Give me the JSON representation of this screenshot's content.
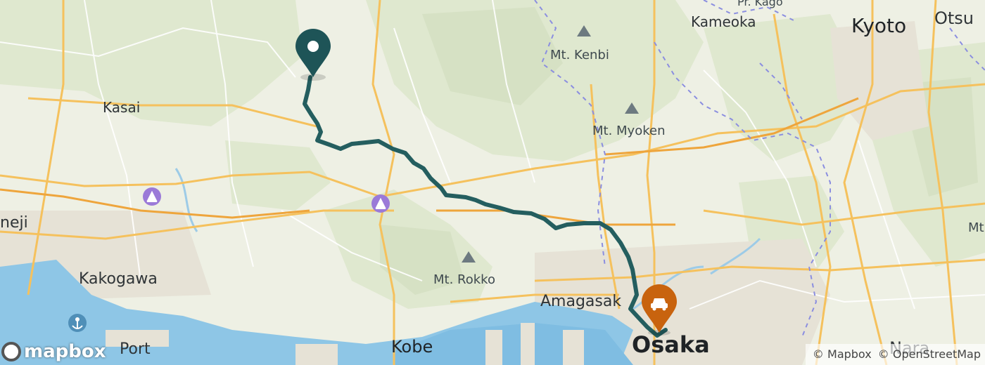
{
  "map": {
    "labels": {
      "kyoto": "Kyoto",
      "otsu": "Otsu",
      "kameoka": "Kameoka",
      "kasai": "Kasai",
      "himeji_partial": "neji",
      "kakogawa": "Kakogawa",
      "amagasaki": "Amagasak",
      "kobe": "Kobe",
      "osaka": "Osaka",
      "nara": "Nara",
      "port_partial": "Port",
      "mt_kenbi": "Mt. Kenbi",
      "mt_myoken": "Mt. Myoken",
      "mt_rokko": "Mt. Rokko",
      "top_partial": "Pr. Kago",
      "right_partial": "Mt"
    },
    "route_color": "#245e5f",
    "origin_marker_color": "#1e5457",
    "destination_marker_color": "#c8630e"
  },
  "attribution": {
    "mapbox": "© Mapbox",
    "osm": "© OpenStreetMap"
  },
  "logo": {
    "text": "mapbox"
  }
}
